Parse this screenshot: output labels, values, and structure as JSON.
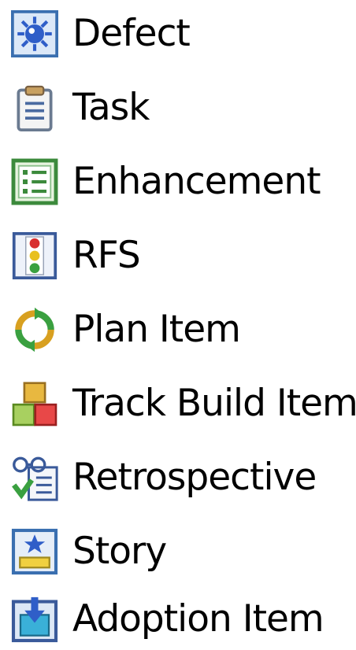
{
  "work_item_types": {
    "items": [
      {
        "label": "Defect",
        "icon": "defect-icon"
      },
      {
        "label": "Task",
        "icon": "task-icon"
      },
      {
        "label": "Enhancement",
        "icon": "enhancement-icon"
      },
      {
        "label": "RFS",
        "icon": "rfs-icon"
      },
      {
        "label": "Plan Item",
        "icon": "plan-item-icon"
      },
      {
        "label": "Track Build Item",
        "icon": "track-build-item-icon"
      },
      {
        "label": "Retrospective",
        "icon": "retrospective-icon"
      },
      {
        "label": "Story",
        "icon": "story-icon"
      },
      {
        "label": "Adoption Item",
        "icon": "adoption-item-icon"
      }
    ]
  },
  "colors": {
    "text": "#000000",
    "icon_blue": "#3a6fb0",
    "icon_green": "#3c8a3c",
    "icon_red": "#d83030",
    "icon_yellow": "#e8c020"
  }
}
